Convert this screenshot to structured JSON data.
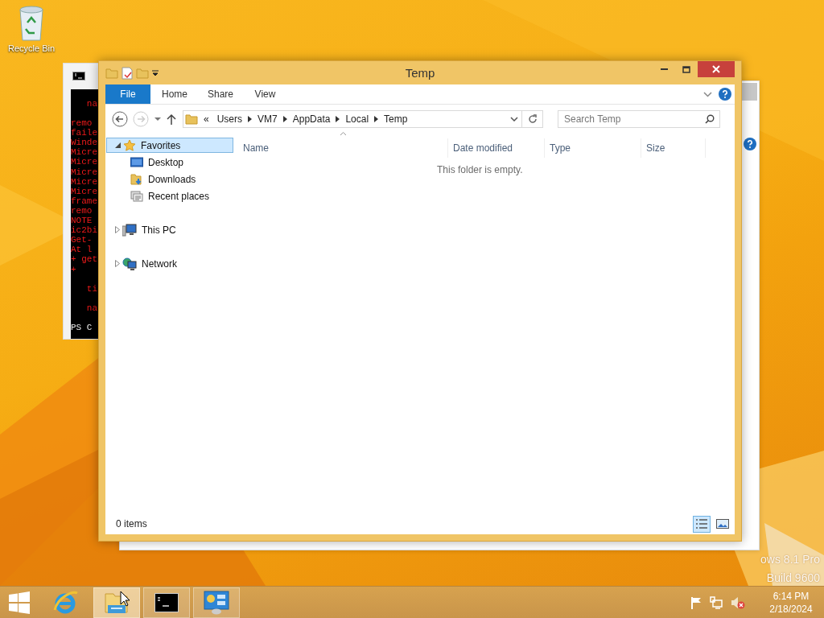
{
  "desktop": {
    "icons": [
      {
        "label": "Recycle Bin"
      }
    ]
  },
  "console_window": {
    "blocks": [
      [
        "   na"
      ],
      [
        "remo",
        "faile",
        "Winde",
        "Micre",
        "Micre",
        "Micre",
        "Micre",
        "Micre",
        "frame",
        "remo",
        "NOTE",
        "ic2bi",
        "Get-",
        "At l",
        "+ get",
        "+"
      ],
      [
        "   ti"
      ],
      [
        "   na"
      ],
      [
        "PS C"
      ]
    ]
  },
  "explorer": {
    "title": "Temp",
    "ribbon_tabs": [
      {
        "label": "File",
        "selected": true
      },
      {
        "label": "Home",
        "selected": false
      },
      {
        "label": "Share",
        "selected": false
      },
      {
        "label": "View",
        "selected": false
      }
    ],
    "address": {
      "overflow": "«",
      "path": [
        "Users",
        "VM7",
        "AppData",
        "Local",
        "Temp"
      ]
    },
    "search": {
      "placeholder": "Search Temp"
    },
    "nav": [
      {
        "label": "Favorites",
        "kind": "favorites",
        "expanded": true,
        "selected": true,
        "children": [
          {
            "label": "Desktop",
            "kind": "desktop",
            "selected": false
          },
          {
            "label": "Downloads",
            "kind": "downloads",
            "selected": false
          },
          {
            "label": "Recent places",
            "kind": "recent",
            "selected": false
          }
        ]
      },
      {
        "label": "This PC",
        "kind": "pc",
        "expanded": false,
        "selected": false
      },
      {
        "label": "Network",
        "kind": "network",
        "expanded": false,
        "selected": false
      }
    ],
    "columns": [
      "Name",
      "Date modified",
      "Type",
      "Size"
    ],
    "empty_message": "This folder is empty.",
    "status": "0 items",
    "views": [
      {
        "kind": "details",
        "selected": true
      },
      {
        "kind": "thumbnails",
        "selected": false
      }
    ]
  },
  "watermark": [
    "ows 8.1 Pro",
    "Build 9600"
  ],
  "taskbar": {
    "apps": [
      {
        "kind": "start",
        "running": false,
        "active": false
      },
      {
        "kind": "browser",
        "running": false,
        "active": false
      },
      {
        "kind": "explorer",
        "running": true,
        "active": true
      },
      {
        "kind": "console",
        "running": true,
        "active": false
      },
      {
        "kind": "control-panel",
        "running": true,
        "active": false
      }
    ],
    "clock": {
      "time": "6:14 PM",
      "date": "2/18/2024"
    }
  }
}
